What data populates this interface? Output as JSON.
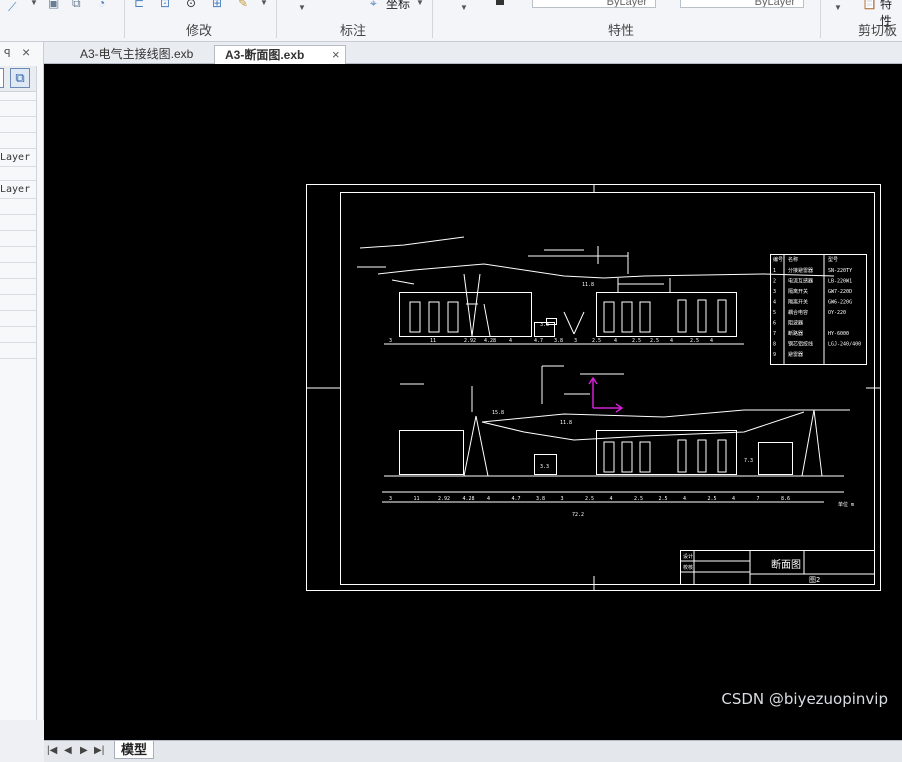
{
  "ribbon": {
    "groups": [
      {
        "label": "修改"
      },
      {
        "label": "标注"
      },
      {
        "label": "特性"
      },
      {
        "label": "剪切板"
      }
    ],
    "coord_label": "坐标",
    "combo1": "ByLayer",
    "combo2": "ByLayer",
    "paste_label": "特性"
  },
  "left_panel": {
    "pin": "ꟼ",
    "close": "×",
    "layer_items": [
      "Layer",
      "Layer"
    ]
  },
  "tabs": [
    {
      "label": "A3-电气主接线图.exb",
      "active": false
    },
    {
      "label": "A3-断面图.exb",
      "active": true
    }
  ],
  "tab_close": "×",
  "bottom": {
    "model_tab": "模型",
    "nav": [
      "|◀",
      "◀",
      "▶",
      "▶|"
    ]
  },
  "drawing": {
    "title": "断面图",
    "sheet_no": "图2",
    "tb_cells": [
      "设计",
      "校核"
    ],
    "scale_note": "单位 m",
    "dims_top": [
      "3",
      "11",
      "2.92",
      "4.28",
      "4",
      "4.7",
      "3.8",
      "3",
      "2.5",
      "4",
      "2.5",
      "2.5",
      "4",
      "2.5",
      "4"
    ],
    "dims_bottom": [
      "3",
      "11",
      "2.92",
      "4.28",
      "4",
      "4.7",
      "3.8",
      "3",
      "2.5",
      "4",
      "2.5",
      "2.5",
      "4",
      "2.5",
      "4",
      "7",
      "8.6"
    ],
    "total": "72.2",
    "heights": [
      "15.8",
      "11.8",
      "7.3",
      "3.3",
      "6.2"
    ],
    "legend_header": [
      "编号",
      "名称",
      "型号"
    ],
    "legend": [
      [
        "1",
        "分接避雷器",
        "SN-220TY"
      ],
      [
        "2",
        "电流互感器",
        "LB-220W1"
      ],
      [
        "3",
        "隔离开关",
        "GW7-220D"
      ],
      [
        "4",
        "隔离开关",
        "GW6-220G"
      ],
      [
        "5",
        "耦合电容",
        "OY-220"
      ],
      [
        "6",
        "阻波器",
        ""
      ],
      [
        "7",
        "断路器",
        "HY-6000"
      ],
      [
        "8",
        "钢芯铝绞线",
        "LGJ-240/400"
      ],
      [
        "9",
        "避雷器",
        ""
      ]
    ]
  },
  "watermark": "CSDN @biyezuopinvip"
}
